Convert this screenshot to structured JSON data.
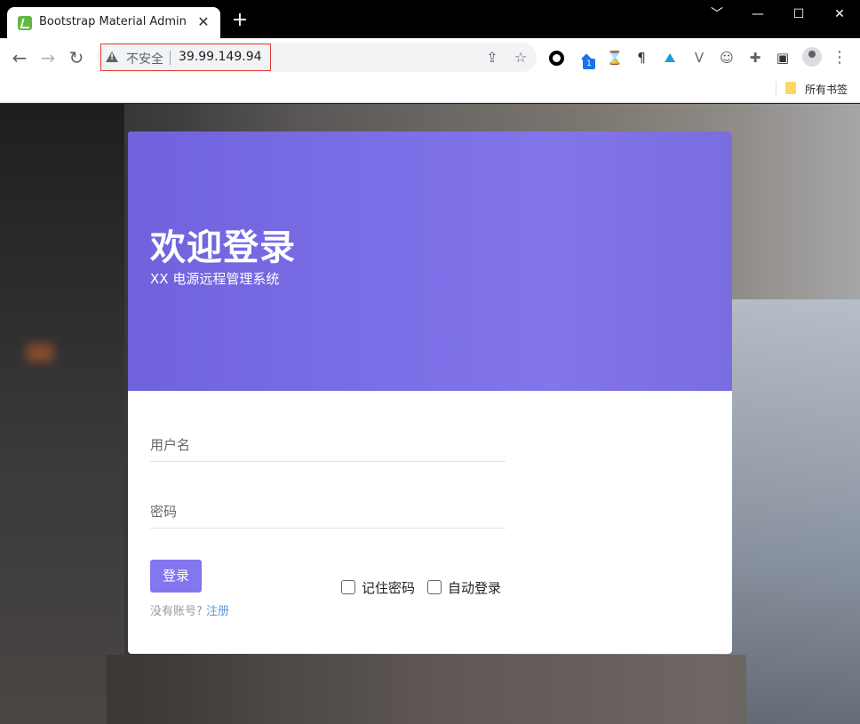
{
  "browser": {
    "tab_title": "Bootstrap Material Admin",
    "tab_close": "✕",
    "new_tab": "+",
    "window_controls": {
      "minimize": "﹀",
      "min": "—",
      "max": "☐",
      "close": "✕"
    },
    "nav": {
      "back": "←",
      "forward": "→",
      "reload": "↻"
    },
    "omnibox": {
      "security_label": "不安全",
      "url": "39.99.149.94"
    },
    "omnibox_actions": {
      "share": "⇪",
      "star": "☆"
    },
    "extensions": [
      "circle-icon",
      "fox-icon",
      "hourglass-icon",
      "pilcrow-icon",
      "mountain-icon",
      "v-icon",
      "ghost-icon",
      "puzzle-icon",
      "sidepanel-icon"
    ],
    "extension_badge": "1",
    "ext_glyphs": {
      "pilcrow": "¶",
      "mountain": "⛰",
      "v": "V",
      "ghost": "☺",
      "puzzle": "✚",
      "sidepanel": "▣",
      "hourglass": "⌛",
      "fox": "◆"
    },
    "menu": "⋮",
    "bookmark_folder_label": "所有书签"
  },
  "login": {
    "title": "欢迎登录",
    "subtitle": "XX 电源远程管理系统",
    "username_placeholder": "用户名",
    "password_placeholder": "密码",
    "login_button": "登录",
    "remember_password": "记住密码",
    "auto_login": "自动登录",
    "no_account_text": "没有账号?",
    "register_link": "注册"
  },
  "colors": {
    "header_accent": "#7a6ee6",
    "button": "#8376ef",
    "link": "#5b9bd5"
  }
}
